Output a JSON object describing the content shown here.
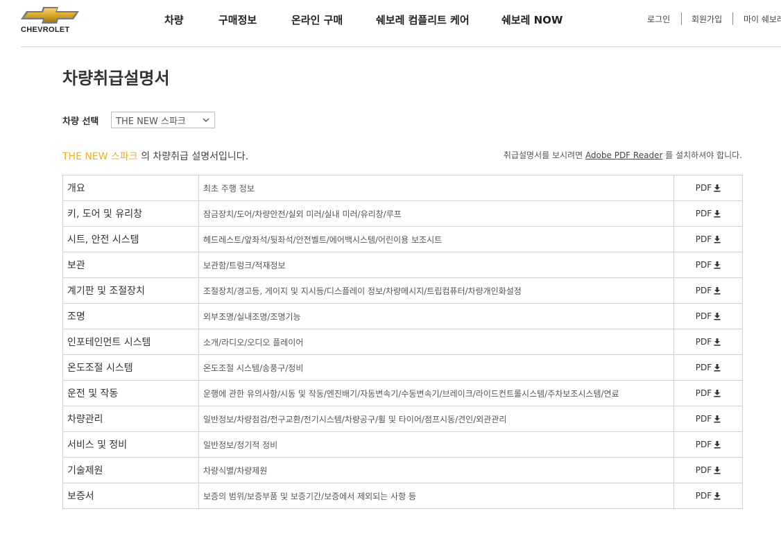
{
  "brand": {
    "logo_text": "CHEVROLET",
    "logo_color": "#d9a728"
  },
  "nav": [
    {
      "label": "차량"
    },
    {
      "label": "구매정보"
    },
    {
      "label": "온라인 구매"
    },
    {
      "label": "쉐보레 컴플리트 케어"
    },
    {
      "label": "쉐보레 NOW"
    }
  ],
  "util": {
    "login": "로그인",
    "signup": "회원가입",
    "mypage": "마이 쉐보레"
  },
  "page": {
    "title": "차량취급설명서",
    "select_label": "차량 선택",
    "selected_model": "THE NEW 스파크",
    "intro_model": "THE NEW 스파크",
    "intro_suffix": " 의 차량취급 설명서입니다.",
    "notice_prefix": "취급설명서를 보시려면 ",
    "notice_link": "Adobe PDF Reader",
    "notice_suffix": " 를 설치하셔야 합니다.",
    "highlight_color": "#e8b02a"
  },
  "manuals": [
    {
      "title": "개요",
      "desc": "최초 주행 정보",
      "pdf": "PDF"
    },
    {
      "title": "키, 도어 및 유리창",
      "desc": "잠금장치/도어/차량안전/실외 미러/실내 미러/유리창/루프",
      "pdf": "PDF"
    },
    {
      "title": "시트, 안전 시스템",
      "desc": "헤드레스트/앞좌석/뒷좌석/안전벨트/에어백시스템/어린이용 보조시트",
      "pdf": "PDF"
    },
    {
      "title": "보관",
      "desc": "보관함/트렁크/적재정보",
      "pdf": "PDF"
    },
    {
      "title": "계기판 및 조절장치",
      "desc": "조절장치/경고등, 게이지 및 지시등/디스플레이 정보/차량메시지/트립컴퓨터/차량개인화설정",
      "pdf": "PDF"
    },
    {
      "title": "조명",
      "desc": "외부조명/실내조명/조명기능",
      "pdf": "PDF"
    },
    {
      "title": "인포테인먼트 시스템",
      "desc": "소개/라디오/오디오 플레이어",
      "pdf": "PDF"
    },
    {
      "title": "온도조절 시스템",
      "desc": "온도조절 시스템/송풍구/정비",
      "pdf": "PDF"
    },
    {
      "title": "운전 및 작동",
      "desc": "운행에 관한 유의사항/시동 및 작동/엔진배기/자동변속기/수동변속기/브레이크/라이드컨트롤시스템/주차보조시스템/연료",
      "pdf": "PDF"
    },
    {
      "title": "차량관리",
      "desc": "일반정보/차량점검/전구교환/전기시스템/차량공구/휠 및 타이어/점프시동/견인/외관관리",
      "pdf": "PDF"
    },
    {
      "title": "서비스 및 정비",
      "desc": "일반정보/정기적 정비",
      "pdf": "PDF"
    },
    {
      "title": "기술제원",
      "desc": "차량식별/차량제원",
      "pdf": "PDF"
    },
    {
      "title": "보증서",
      "desc": "보증의 범위/보증부품 및 보증기간/보증에서 제외되는 사항 등",
      "pdf": "PDF"
    }
  ]
}
